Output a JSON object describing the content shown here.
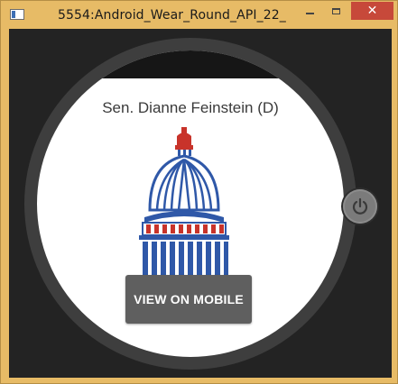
{
  "window": {
    "title": "5554:Android_Wear_Round_API_22_",
    "close_glyph": "✕"
  },
  "card": {
    "senator_name": "Sen. Dianne Feinstein (D)",
    "image_icon": "capitol-dome-icon",
    "button_label": "VIEW ON MOBILE"
  },
  "controls": {
    "power_icon": "power-icon"
  },
  "colors": {
    "window_frame": "#E7BB66",
    "close_button": "#C7493A",
    "emulator_background": "#232323",
    "bezel": "#3e3e3e",
    "screen": "#ffffff",
    "button": "#5f5f5f",
    "dome_blue": "#2f58a8",
    "dome_red": "#c8332a"
  }
}
